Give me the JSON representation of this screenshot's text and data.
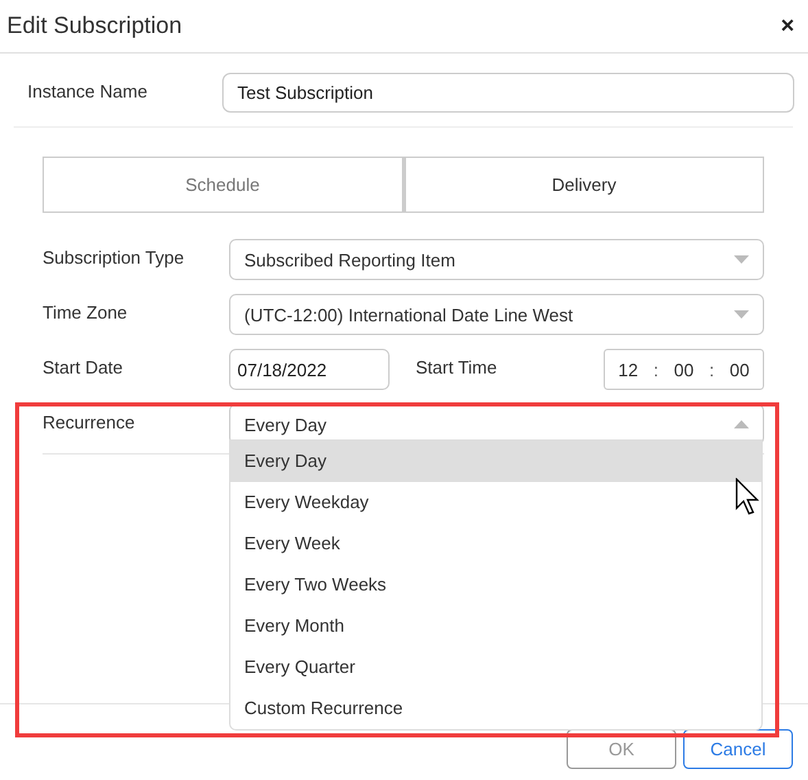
{
  "dialog": {
    "title": "Edit Subscription",
    "close": "×"
  },
  "instance_name": {
    "label": "Instance Name",
    "value": "Test Subscription"
  },
  "tabs": [
    {
      "label": "Schedule",
      "selected": true
    },
    {
      "label": "Delivery",
      "selected": false
    }
  ],
  "fields": [
    {
      "kind": "select",
      "label": "Subscription Type",
      "value": "Subscribed Reporting Item",
      "open": false
    },
    {
      "kind": "select",
      "label": "Time Zone",
      "value": "(UTC-12:00) International Date Line West",
      "open": false
    }
  ],
  "start_date": {
    "label": "Start Date",
    "value": "07/18/2022"
  },
  "start_time": {
    "label": "Start Time",
    "hours": "12",
    "minutes": "00",
    "seconds": "00",
    "separator": ":"
  },
  "recurrence": {
    "label": "Recurrence",
    "value": "Every Day",
    "open": true,
    "options": [
      {
        "label": "Every Day",
        "selected": true
      },
      {
        "label": "Every Weekday",
        "selected": false
      },
      {
        "label": "Every Week",
        "selected": false
      },
      {
        "label": "Every Two Weeks",
        "selected": false
      },
      {
        "label": "Every Month",
        "selected": false
      },
      {
        "label": "Every Quarter",
        "selected": false
      },
      {
        "label": "Custom Recurrence",
        "selected": false
      }
    ]
  },
  "buttons": [
    {
      "label": "OK",
      "disabled": true
    },
    {
      "label": "Cancel",
      "disabled": false
    }
  ]
}
